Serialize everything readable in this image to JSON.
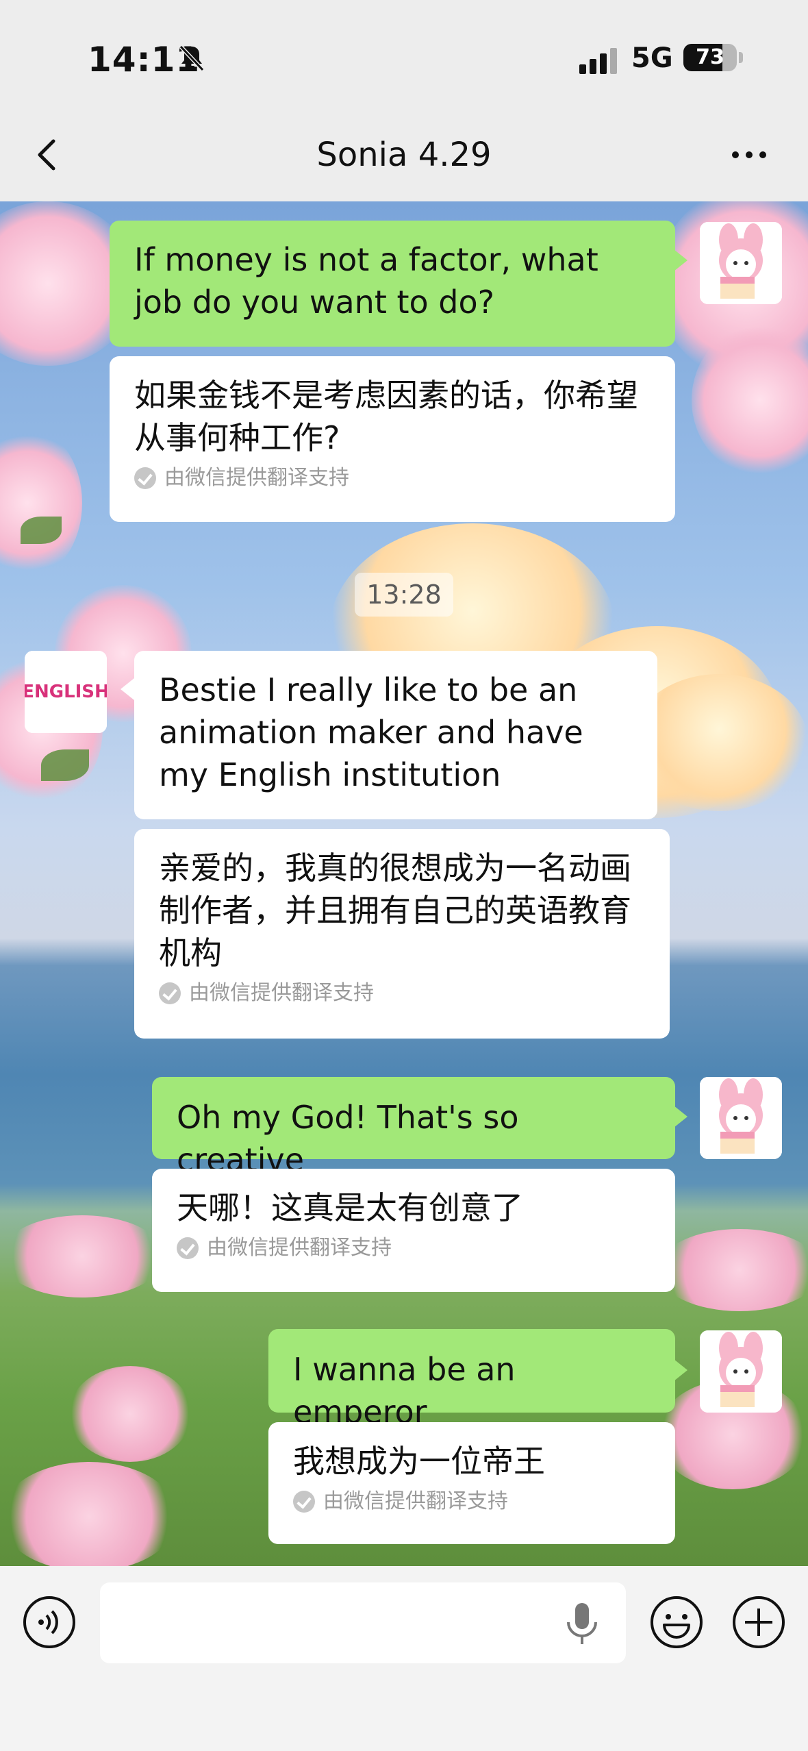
{
  "status_bar": {
    "time": "14:11",
    "network": "5G",
    "battery": "73",
    "battery_level": 0.73
  },
  "header": {
    "title": "Sonia 4.29"
  },
  "messages": [
    {
      "text": "If money is not a factor, what job do you want to do?",
      "translation": "如果金钱不是考虑因素的话，你希望从事何种工作?",
      "note": "由微信提供翻译支持"
    },
    {
      "text": "Bestie I really like to be an animation maker and have my English institution",
      "translation": "亲爱的，我真的很想成为一名动画制作者，并且拥有自己的英语教育机构",
      "note": "由微信提供翻译支持"
    },
    {
      "text": "Oh my God! That's so creative",
      "translation": "天哪！这真是太有创意了",
      "note": "由微信提供翻译支持"
    },
    {
      "text": "I wanna be an emperor",
      "translation": "我想成为一位帝王",
      "note": "由微信提供翻译支持"
    }
  ],
  "timestamp": "13:28",
  "avatar_left_text": "ENGLISH",
  "input": {
    "placeholder": ""
  }
}
